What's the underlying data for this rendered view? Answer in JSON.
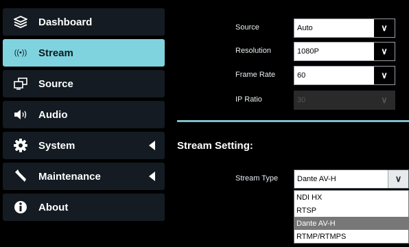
{
  "sidebar": {
    "items": [
      {
        "label": "Dashboard",
        "icon": "layers-icon",
        "active": false,
        "has_caret": false
      },
      {
        "label": "Stream",
        "icon": "broadcast-icon",
        "active": true,
        "has_caret": false
      },
      {
        "label": "Source",
        "icon": "source-icon",
        "active": false,
        "has_caret": false
      },
      {
        "label": "Audio",
        "icon": "speaker-icon",
        "active": false,
        "has_caret": false
      },
      {
        "label": "System",
        "icon": "gear-icon",
        "active": false,
        "has_caret": true
      },
      {
        "label": "Maintenance",
        "icon": "wrench-icon",
        "active": false,
        "has_caret": true
      },
      {
        "label": "About",
        "icon": "info-icon",
        "active": false,
        "has_caret": false
      }
    ]
  },
  "video": {
    "source_label": "Source",
    "source_value": "Auto",
    "resolution_label": "Resolution",
    "resolution_value": "1080P",
    "frame_rate_label": "Frame Rate",
    "frame_rate_value": "60",
    "ip_ratio_label": "IP Ratio",
    "ip_ratio_value": "30"
  },
  "stream_setting": {
    "title": "Stream Setting:",
    "stream_type_label": "Stream Type",
    "stream_type_value": "Dante AV-H",
    "options": [
      "NDI HX",
      "RTSP",
      "Dante AV-H",
      "RTMP/RTMPS"
    ],
    "selected_option": "Dante AV-H"
  },
  "colors": {
    "accent": "#7fd3df",
    "nav_bg": "#141b22",
    "divider": "#7fc0cc"
  }
}
